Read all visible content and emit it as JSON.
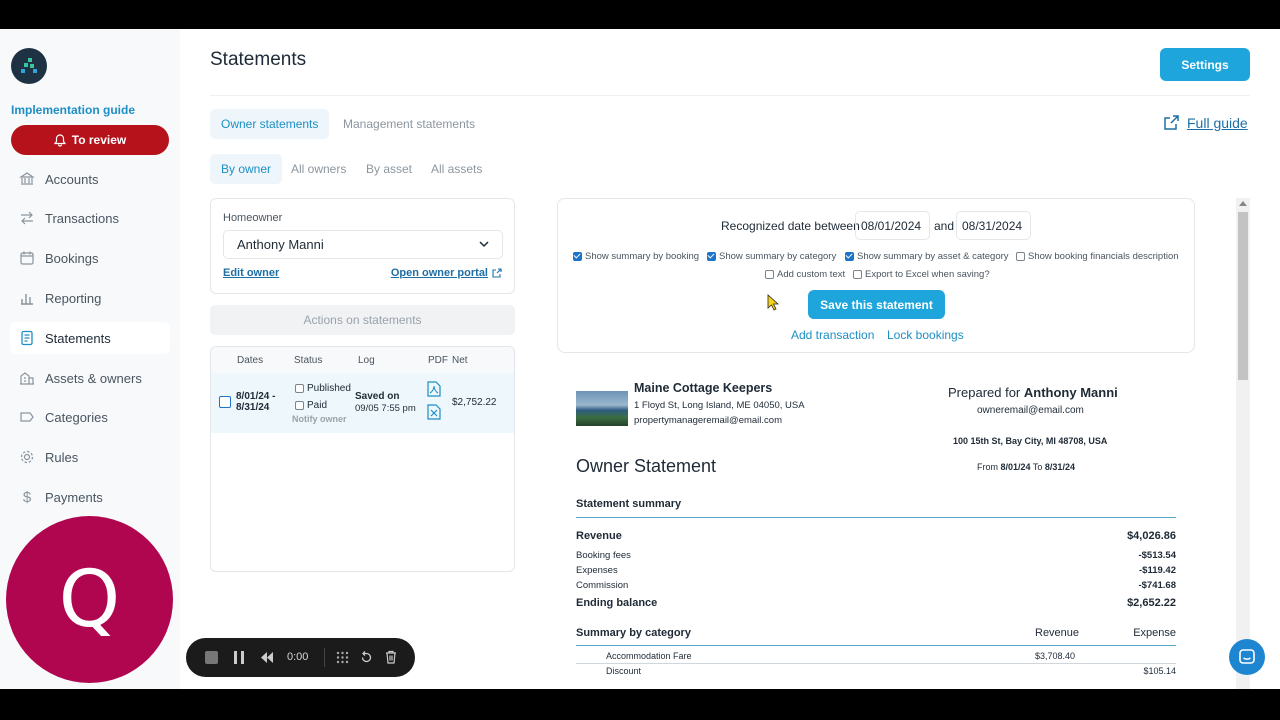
{
  "sidebar": {
    "implementation_guide": "Implementation guide",
    "review_label": "To review",
    "items": [
      {
        "label": "Accounts",
        "icon": "bank-icon"
      },
      {
        "label": "Transactions",
        "icon": "arrows-icon"
      },
      {
        "label": "Bookings",
        "icon": "calendar-icon"
      },
      {
        "label": "Reporting",
        "icon": "bar-chart-icon"
      },
      {
        "label": "Statements",
        "icon": "document-icon",
        "active": true
      },
      {
        "label": "Assets & owners",
        "icon": "building-icon"
      },
      {
        "label": "Categories",
        "icon": "tag-icon"
      },
      {
        "label": "Rules",
        "icon": "gear-icon"
      },
      {
        "label": "Payments",
        "icon": "dollar-icon"
      }
    ]
  },
  "header": {
    "title": "Statements",
    "settings_label": "Settings",
    "full_guide": "Full guide"
  },
  "tabs": [
    "Owner statements",
    "Management statements"
  ],
  "subtabs": [
    "By owner",
    "All owners",
    "By asset",
    "All assets"
  ],
  "owner": {
    "label": "Homeowner",
    "selected": "Anthony Manni",
    "edit": "Edit owner",
    "portal": "Open owner portal"
  },
  "actions_label": "Actions on statements",
  "statements_table": {
    "headers": [
      "Dates",
      "Status",
      "Log",
      "PDF",
      "Net"
    ],
    "row": {
      "dates": "8/01/24 - 8/31/24",
      "published": "Published",
      "paid": "Paid",
      "notify": "Notify owner",
      "log_title": "Saved on",
      "log_date": "09/05 7:55 pm",
      "net": "$2,752.22"
    }
  },
  "controls": {
    "date_label": "Recognized date between",
    "from": "08/01/2024",
    "and": "and",
    "to": "08/31/2024",
    "options": [
      {
        "label": "Show summary by booking",
        "checked": true
      },
      {
        "label": "Show summary by category",
        "checked": true
      },
      {
        "label": "Show summary by asset & category",
        "checked": true
      },
      {
        "label": "Show booking financials description",
        "checked": false
      },
      {
        "label": "Add custom text",
        "checked": false
      },
      {
        "label": "Export to Excel when saving?",
        "checked": false
      }
    ],
    "save_label": "Save this statement",
    "add_transaction": "Add transaction",
    "lock_bookings": "Lock bookings"
  },
  "statement": {
    "company": "Maine Cottage Keepers",
    "company_address": "1 Floyd St, Long Island, ME 04050, USA",
    "company_email": "propertymanageremail@email.com",
    "prepared_for_label": "Prepared for",
    "owner_name": "Anthony Manni",
    "owner_email": "owneremail@email.com",
    "owner_address": "100 15th St, Bay City, MI 48708, USA",
    "title": "Owner Statement",
    "period_from_label": "From",
    "period_from": "8/01/24",
    "period_to_label": "To",
    "period_to": "8/31/24",
    "summary_title": "Statement summary",
    "revenue_label": "Revenue",
    "revenue": "$4,026.86",
    "booking_fees_label": "Booking fees",
    "booking_fees": "-$513.54",
    "expenses_label": "Expenses",
    "expenses": "-$119.42",
    "commission_label": "Commission",
    "commission": "-$741.68",
    "ending_label": "Ending balance",
    "ending": "$2,652.22",
    "by_category_title": "Summary by category",
    "col_revenue": "Revenue",
    "col_expense": "Expense",
    "cat1_label": "Accommodation Fare",
    "cat1_revenue": "$3,708.40",
    "cat2_label": "Discount",
    "cat2_expense": "$105.14"
  },
  "overlay": {
    "avatar_letter": "Q",
    "timer": "0:00"
  },
  "colors": {
    "accent": "#1ea5dc",
    "review": "#b5121b",
    "avatar": "#b0064f"
  }
}
